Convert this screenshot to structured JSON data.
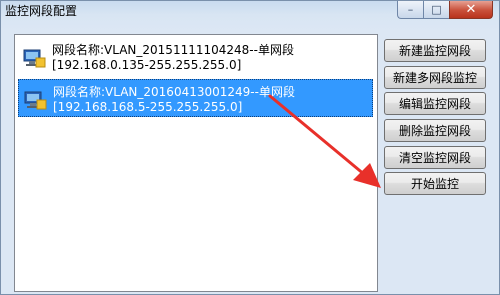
{
  "window": {
    "title": "监控网段配置",
    "controls": {
      "minimize": "–",
      "maximize": "□",
      "close": "✕"
    }
  },
  "list": {
    "items": [
      {
        "line1": "网段名称:VLAN_20151111104248--单网段",
        "line2": "[192.168.0.135-255.255.255.0]",
        "selected": false
      },
      {
        "line1": "网段名称:VLAN_20160413001249--单网段",
        "line2": "[192.168.168.5-255.255.255.0]",
        "selected": true
      }
    ]
  },
  "buttons": {
    "new_segment": "新建监控网段",
    "new_multi_segment": "新建多网段监控",
    "edit_segment": "编辑监控网段",
    "delete_segment": "删除监控网段",
    "clear_segment": "清空监控网段",
    "start_monitor": "开始监控"
  },
  "colors": {
    "selection": "#3399ff",
    "annotation_arrow": "#e8302a"
  }
}
